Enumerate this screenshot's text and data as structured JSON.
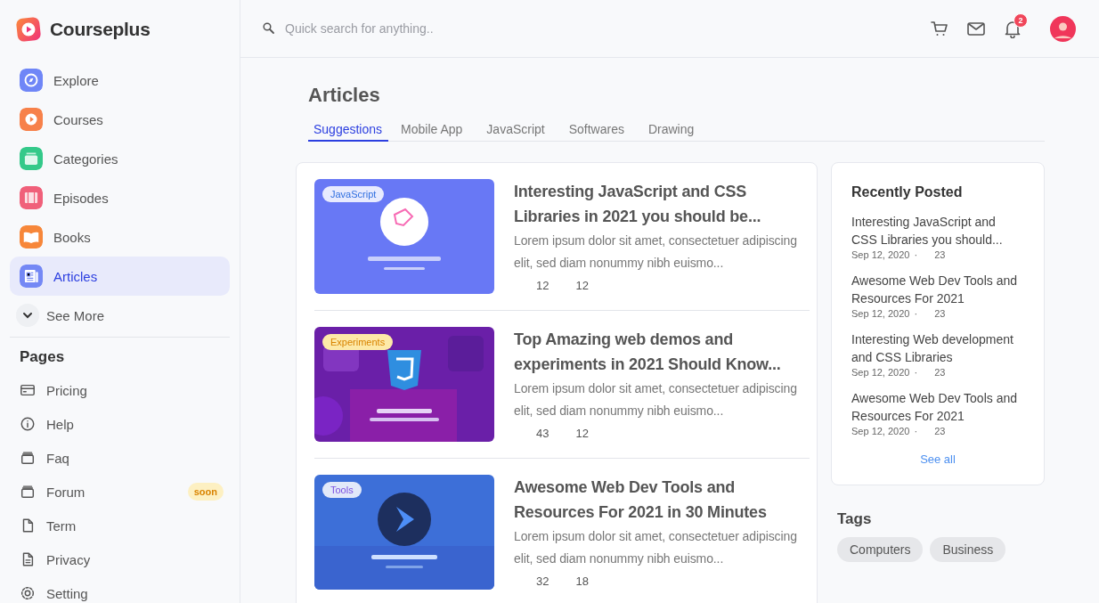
{
  "brand": {
    "name": "Courseplus"
  },
  "nav": [
    {
      "label": "Explore",
      "color": "#6f86f7",
      "selected": false
    },
    {
      "label": "Courses",
      "color": "#f7814a",
      "selected": false
    },
    {
      "label": "Categories",
      "color": "#34c98a",
      "selected": false
    },
    {
      "label": "Episodes",
      "color": "#f0607a",
      "selected": false
    },
    {
      "label": "Books",
      "color": "#f7873a",
      "selected": false
    },
    {
      "label": "Articles",
      "color": "#7488f5",
      "selected": true
    }
  ],
  "see_more": {
    "label": "See More"
  },
  "pages": {
    "title": "Pages",
    "items": [
      {
        "label": "Pricing"
      },
      {
        "label": "Help"
      },
      {
        "label": "Faq"
      },
      {
        "label": "Forum",
        "badge": "soon"
      },
      {
        "label": "Term"
      },
      {
        "label": "Privacy"
      },
      {
        "label": "Setting"
      }
    ]
  },
  "header": {
    "search": {
      "placeholder": "Quick search for anything.."
    },
    "notifications": {
      "count": "2"
    }
  },
  "page_title": "Articles",
  "tabs": [
    {
      "label": "Suggestions",
      "selected": true
    },
    {
      "label": "Mobile App",
      "selected": false
    },
    {
      "label": "JavaScript",
      "selected": false
    },
    {
      "label": "Softwares",
      "selected": false
    },
    {
      "label": "Drawing",
      "selected": false
    }
  ],
  "articles": [
    {
      "tag": "JavaScript",
      "title": "Interesting JavaScript and CSS Libraries in 2021 you should be...",
      "excerpt": "Lorem ipsum dolor sit amet, consectetuer adipiscing elit, sed diam nonummy nibh euismo...",
      "stats": [
        "12",
        "12"
      ]
    },
    {
      "tag": "Experiments",
      "title": "Top Amazing web demos and experiments in 2021 Should Know...",
      "excerpt": "Lorem ipsum dolor sit amet, consectetuer adipiscing elit, sed diam nonummy nibh euismo...",
      "stats": [
        "43",
        "12"
      ]
    },
    {
      "tag": "Tools",
      "title": "Awesome Web Dev Tools and Resources For 2021 in 30 Minutes",
      "excerpt": "Lorem ipsum dolor sit amet, consectetuer adipiscing elit, sed diam nonummy nibh euismo...",
      "stats": [
        "32",
        "18"
      ]
    }
  ],
  "recently_posted": {
    "title": "Recently Posted",
    "items": [
      {
        "title": "Interesting JavaScript and CSS Libraries you should...",
        "date": "Sep 12, 2020",
        "separator": "·",
        "count": "23"
      },
      {
        "title": "Awesome Web Dev Tools and Resources For 2021",
        "date": "Sep 12, 2020",
        "separator": "·",
        "count": "23"
      },
      {
        "title": "Interesting Web development and CSS Libraries",
        "date": "Sep 12, 2020",
        "separator": "·",
        "count": "23"
      },
      {
        "title": "Awesome Web Dev Tools and Resources For 2021",
        "date": "Sep 12, 2020",
        "separator": "·",
        "count": "23"
      }
    ],
    "see_all": "See all"
  },
  "tags": {
    "title": "Tags",
    "items": [
      "Computers",
      "Business"
    ]
  }
}
